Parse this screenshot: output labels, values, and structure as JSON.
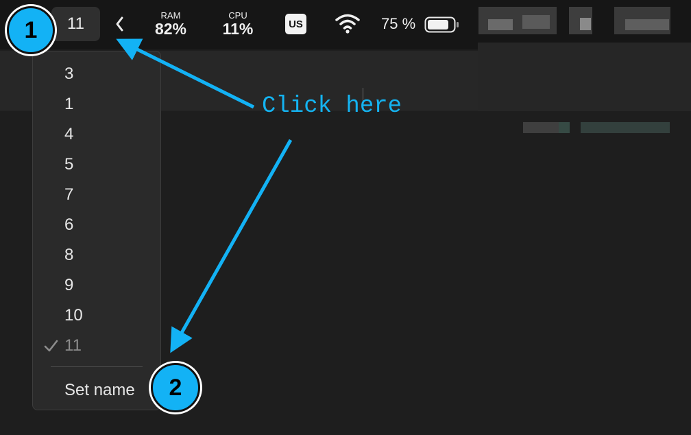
{
  "menubar": {
    "workspace_current": "11",
    "ram": {
      "label": "RAM",
      "value": "82%"
    },
    "cpu": {
      "label": "CPU",
      "value": "11%"
    },
    "input_source": "US",
    "battery_percent": "75 %"
  },
  "dropdown": {
    "items": [
      {
        "label": "3",
        "checked": false
      },
      {
        "label": "1",
        "checked": false
      },
      {
        "label": "4",
        "checked": false
      },
      {
        "label": "5",
        "checked": false
      },
      {
        "label": "7",
        "checked": false
      },
      {
        "label": "6",
        "checked": false
      },
      {
        "label": "8",
        "checked": false
      },
      {
        "label": "9",
        "checked": false
      },
      {
        "label": "10",
        "checked": false
      },
      {
        "label": "11",
        "checked": true
      }
    ],
    "action_label": "Set name"
  },
  "annotations": {
    "step1": "1",
    "step2": "2",
    "instruction": "Click here",
    "color": "#13b2f5"
  }
}
